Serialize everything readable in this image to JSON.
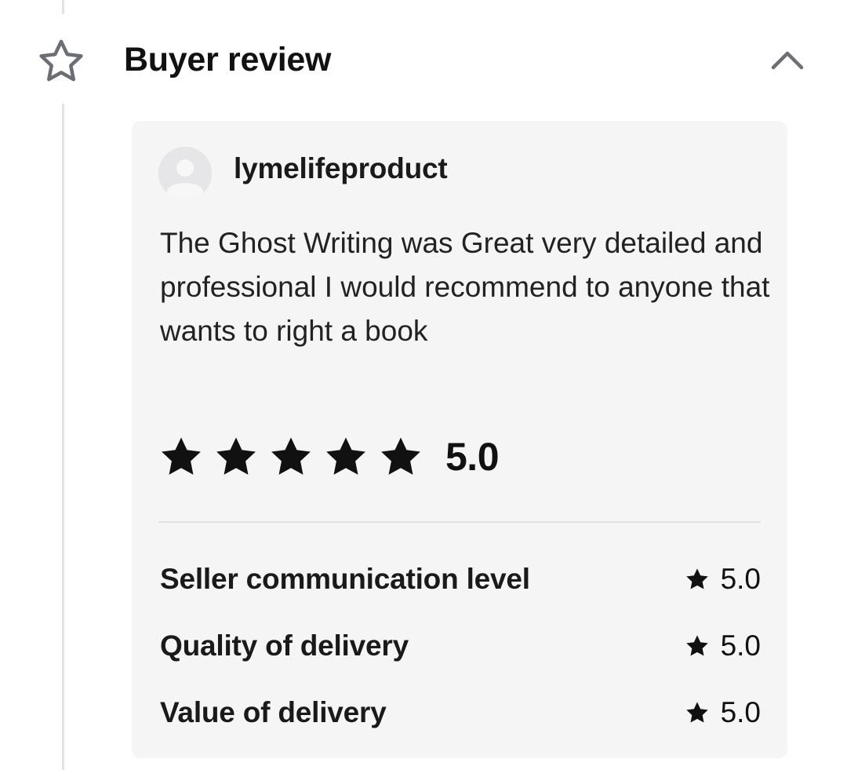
{
  "section": {
    "title": "Buyer review",
    "icon": "star-outline-icon",
    "collapse_icon": "chevron-up-icon"
  },
  "review": {
    "username": "lymelifeproduct",
    "avatar_icon": "default-avatar-icon",
    "text": "The Ghost Writing was Great very detailed and professional I would recommend to anyone that wants to right a book",
    "overall_rating": "5.0",
    "stars": 5,
    "sub_ratings": [
      {
        "label": "Seller communication level",
        "value": "5.0"
      },
      {
        "label": "Quality of delivery",
        "value": "5.0"
      },
      {
        "label": "Value of delivery",
        "value": "5.0"
      }
    ]
  },
  "colors": {
    "star_fill": "#111111",
    "card_background": "#f5f5f5",
    "muted_icon": "#6b6e75"
  }
}
